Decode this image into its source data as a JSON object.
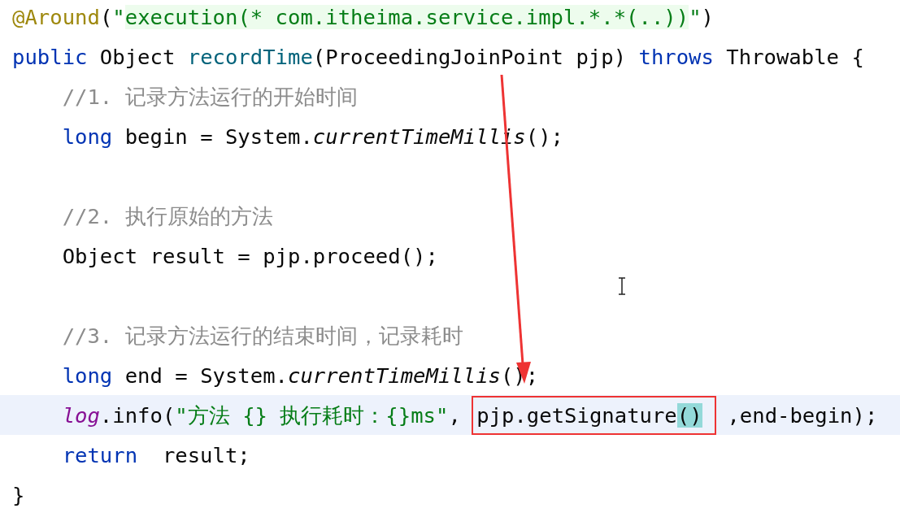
{
  "editor": {
    "lines": [
      {
        "kind": "top",
        "current": false,
        "segments": [
          {
            "outlined": false,
            "tokens": [
              {
                "kind": "annotation",
                "text": "@Around"
              },
              {
                "kind": "plain",
                "text": "("
              },
              {
                "kind": "string",
                "text": "\""
              },
              {
                "kind": "injected",
                "text": "execution(* com.itheima.service.impl.*.*(..))"
              },
              {
                "kind": "string",
                "text": "\""
              },
              {
                "kind": "plain",
                "text": ")"
              }
            ]
          }
        ]
      },
      {
        "kind": "top",
        "current": false,
        "segments": [
          {
            "outlined": false,
            "tokens": [
              {
                "kind": "keyword",
                "text": "public"
              },
              {
                "kind": "plain",
                "text": " Object "
              },
              {
                "kind": "method",
                "text": "recordTime"
              },
              {
                "kind": "plain",
                "text": "(ProceedingJoinPoint pjp) "
              },
              {
                "kind": "keyword",
                "text": "throws"
              },
              {
                "kind": "plain",
                "text": " Throwable {"
              }
            ]
          }
        ]
      },
      {
        "kind": "body",
        "current": false,
        "segments": [
          {
            "outlined": false,
            "tokens": [
              {
                "kind": "comment",
                "text": "//1. 记录方法运行的开始时间"
              }
            ]
          }
        ]
      },
      {
        "kind": "body",
        "current": false,
        "segments": [
          {
            "outlined": false,
            "tokens": [
              {
                "kind": "keyword",
                "text": "long"
              },
              {
                "kind": "plain",
                "text": " begin = System."
              },
              {
                "kind": "static",
                "text": "currentTimeMillis"
              },
              {
                "kind": "plain",
                "text": "();"
              }
            ]
          }
        ]
      },
      {
        "kind": "blank"
      },
      {
        "kind": "body",
        "current": false,
        "segments": [
          {
            "outlined": false,
            "tokens": [
              {
                "kind": "comment",
                "text": "//2. 执行原始的方法"
              }
            ]
          }
        ]
      },
      {
        "kind": "body",
        "current": false,
        "segments": [
          {
            "outlined": false,
            "tokens": [
              {
                "kind": "plain",
                "text": "Object result = pjp.proceed();"
              }
            ]
          }
        ]
      },
      {
        "kind": "blank"
      },
      {
        "kind": "body",
        "current": false,
        "segments": [
          {
            "outlined": false,
            "tokens": [
              {
                "kind": "comment",
                "text": "//3. 记录方法运行的结束时间，记录耗时"
              }
            ]
          }
        ]
      },
      {
        "kind": "body",
        "current": false,
        "segments": [
          {
            "outlined": false,
            "tokens": [
              {
                "kind": "keyword",
                "text": "long"
              },
              {
                "kind": "plain",
                "text": " end = System."
              },
              {
                "kind": "static",
                "text": "currentTimeMillis"
              },
              {
                "kind": "plain",
                "text": "();"
              }
            ]
          }
        ]
      },
      {
        "kind": "body",
        "current": true,
        "segments": [
          {
            "outlined": false,
            "tokens": [
              {
                "kind": "field",
                "text": "log"
              },
              {
                "kind": "plain",
                "text": ".info("
              },
              {
                "kind": "string",
                "text": "\"方法 {} 执行耗时：{}ms\""
              },
              {
                "kind": "plain",
                "text": ","
              }
            ]
          },
          {
            "outlined": true,
            "tokens": [
              {
                "kind": "plain",
                "text": "pjp.getSignature"
              },
              {
                "kind": "match",
                "text": "()"
              }
            ]
          },
          {
            "outlined": false,
            "tokens": [
              {
                "kind": "plain",
                "text": ",end-begin);"
              }
            ]
          }
        ]
      },
      {
        "kind": "body",
        "current": false,
        "segments": [
          {
            "outlined": false,
            "tokens": [
              {
                "kind": "keyword",
                "text": "return"
              },
              {
                "kind": "plain",
                "text": "  result;"
              }
            ]
          }
        ]
      },
      {
        "kind": "top",
        "current": false,
        "segments": [
          {
            "outlined": false,
            "tokens": [
              {
                "kind": "plain",
                "text": "}"
              }
            ]
          }
        ]
      }
    ]
  }
}
